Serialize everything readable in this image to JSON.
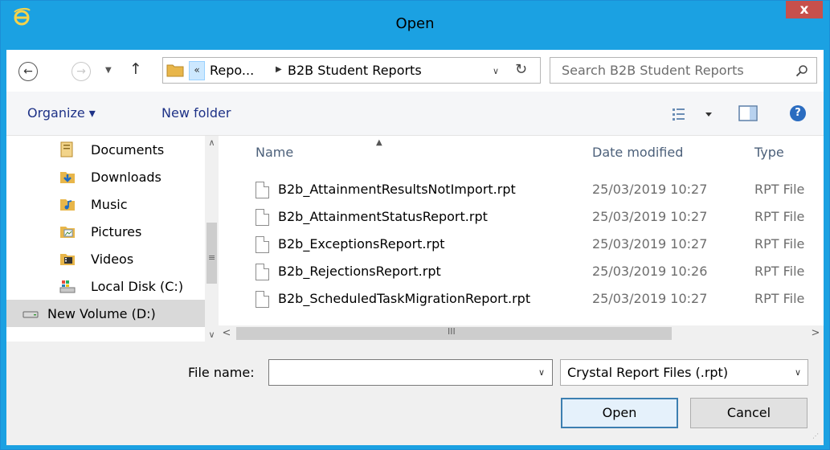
{
  "window": {
    "title": "Open",
    "close_label": "x"
  },
  "nav": {
    "breadcrumb_overflow": "«",
    "breadcrumb_parent": "Repo...",
    "breadcrumb_current": "B2B Student Reports"
  },
  "search": {
    "placeholder": "Search B2B Student Reports"
  },
  "toolbar": {
    "organize_label": "Organize ▾",
    "new_folder_label": "New folder",
    "help_label": "?"
  },
  "sidebar": {
    "items": [
      {
        "label": "Documents",
        "icon": "documents-icon"
      },
      {
        "label": "Downloads",
        "icon": "downloads-icon"
      },
      {
        "label": "Music",
        "icon": "music-icon"
      },
      {
        "label": "Pictures",
        "icon": "pictures-icon"
      },
      {
        "label": "Videos",
        "icon": "videos-icon"
      },
      {
        "label": "Local Disk (C:)",
        "icon": "local-disk-icon"
      },
      {
        "label": "New Volume (D:)",
        "icon": "drive-icon",
        "selected": true
      }
    ]
  },
  "file_list": {
    "columns": {
      "name": "Name",
      "date": "Date modified",
      "type": "Type"
    },
    "rows": [
      {
        "name": "B2b_AttainmentResultsNotImport.rpt",
        "date": "25/03/2019 10:27",
        "type": "RPT File"
      },
      {
        "name": "B2b_AttainmentStatusReport.rpt",
        "date": "25/03/2019 10:27",
        "type": "RPT File"
      },
      {
        "name": "B2b_ExceptionsReport.rpt",
        "date": "25/03/2019 10:27",
        "type": "RPT File"
      },
      {
        "name": "B2b_RejectionsReport.rpt",
        "date": "25/03/2019 10:26",
        "type": "RPT File"
      },
      {
        "name": "B2b_ScheduledTaskMigrationReport.rpt",
        "date": "25/03/2019 10:27",
        "type": "RPT File"
      }
    ]
  },
  "footer": {
    "file_name_label": "File name:",
    "file_name_value": "",
    "file_type_value": "Crystal Report Files (.rpt)",
    "open_label": "Open",
    "cancel_label": "Cancel"
  },
  "colors": {
    "accent": "#1ba1e2",
    "close": "#c7504c",
    "link": "#1e3287"
  }
}
